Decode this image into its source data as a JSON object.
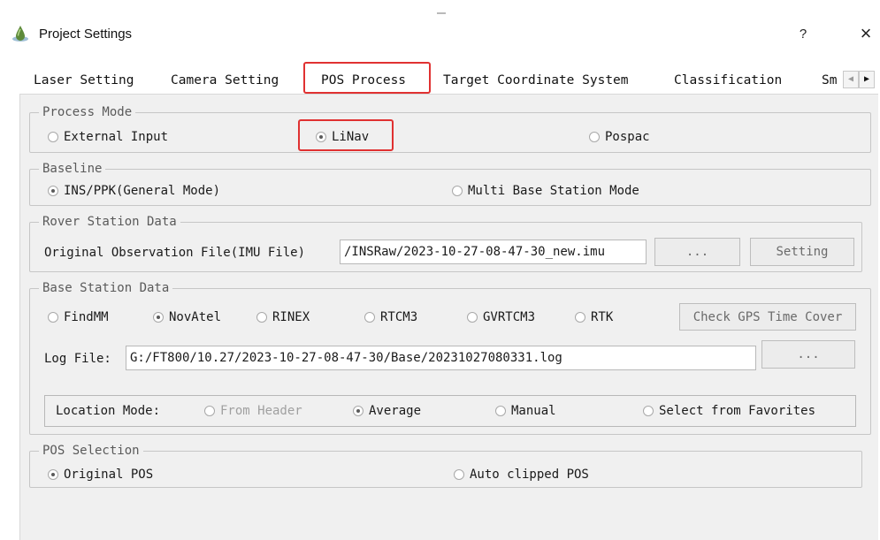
{
  "window": {
    "title": "Project Settings",
    "help": "?",
    "close": "×"
  },
  "tabs": [
    {
      "label": "Laser Setting"
    },
    {
      "label": "Camera Setting"
    },
    {
      "label": "POS Process"
    },
    {
      "label": "Target Coordinate System"
    },
    {
      "label": "Classification"
    },
    {
      "label": "Sm"
    }
  ],
  "active_tab": "POS Process",
  "process_mode": {
    "title": "Process Mode",
    "options": [
      "External Input",
      "LiNav",
      "Pospac"
    ],
    "selected": "LiNav"
  },
  "baseline": {
    "title": "Baseline",
    "options": [
      "INS/PPK(General Mode)",
      "Multi Base Station  Mode"
    ],
    "selected": "INS/PPK(General Mode)"
  },
  "rover": {
    "title": "Rover Station Data",
    "file_label": "Original Observation File(IMU File)",
    "file_value": "/INSRaw/2023-10-27-08-47-30_new.imu",
    "browse_label": "...",
    "setting_label": "Setting"
  },
  "base": {
    "title": "Base Station Data",
    "formats": [
      "FindMM",
      "NovAtel",
      "RINEX",
      "RTCM3",
      "GVRTCM3",
      "RTK"
    ],
    "selected_format": "NovAtel",
    "check_button": "Check GPS Time Cover",
    "log_label": "Log File:",
    "log_value": "G:/FT800/10.27/2023-10-27-08-47-30/Base/20231027080331.log",
    "browse_label": "...",
    "location_label": "Location Mode:",
    "location_options": [
      "From Header",
      "Average",
      "Manual",
      "Select from Favorites"
    ],
    "location_selected": "Average"
  },
  "pos_selection": {
    "title": "POS Selection",
    "options": [
      "Original POS",
      "Auto clipped POS"
    ],
    "selected": "Original POS"
  },
  "colors": {
    "highlight": "#e03131",
    "panel_bg": "#f0f0f0"
  },
  "icons": {
    "app": "water-drop-icon",
    "tab_prev": "chevron-left-icon",
    "tab_next": "chevron-right-icon"
  }
}
